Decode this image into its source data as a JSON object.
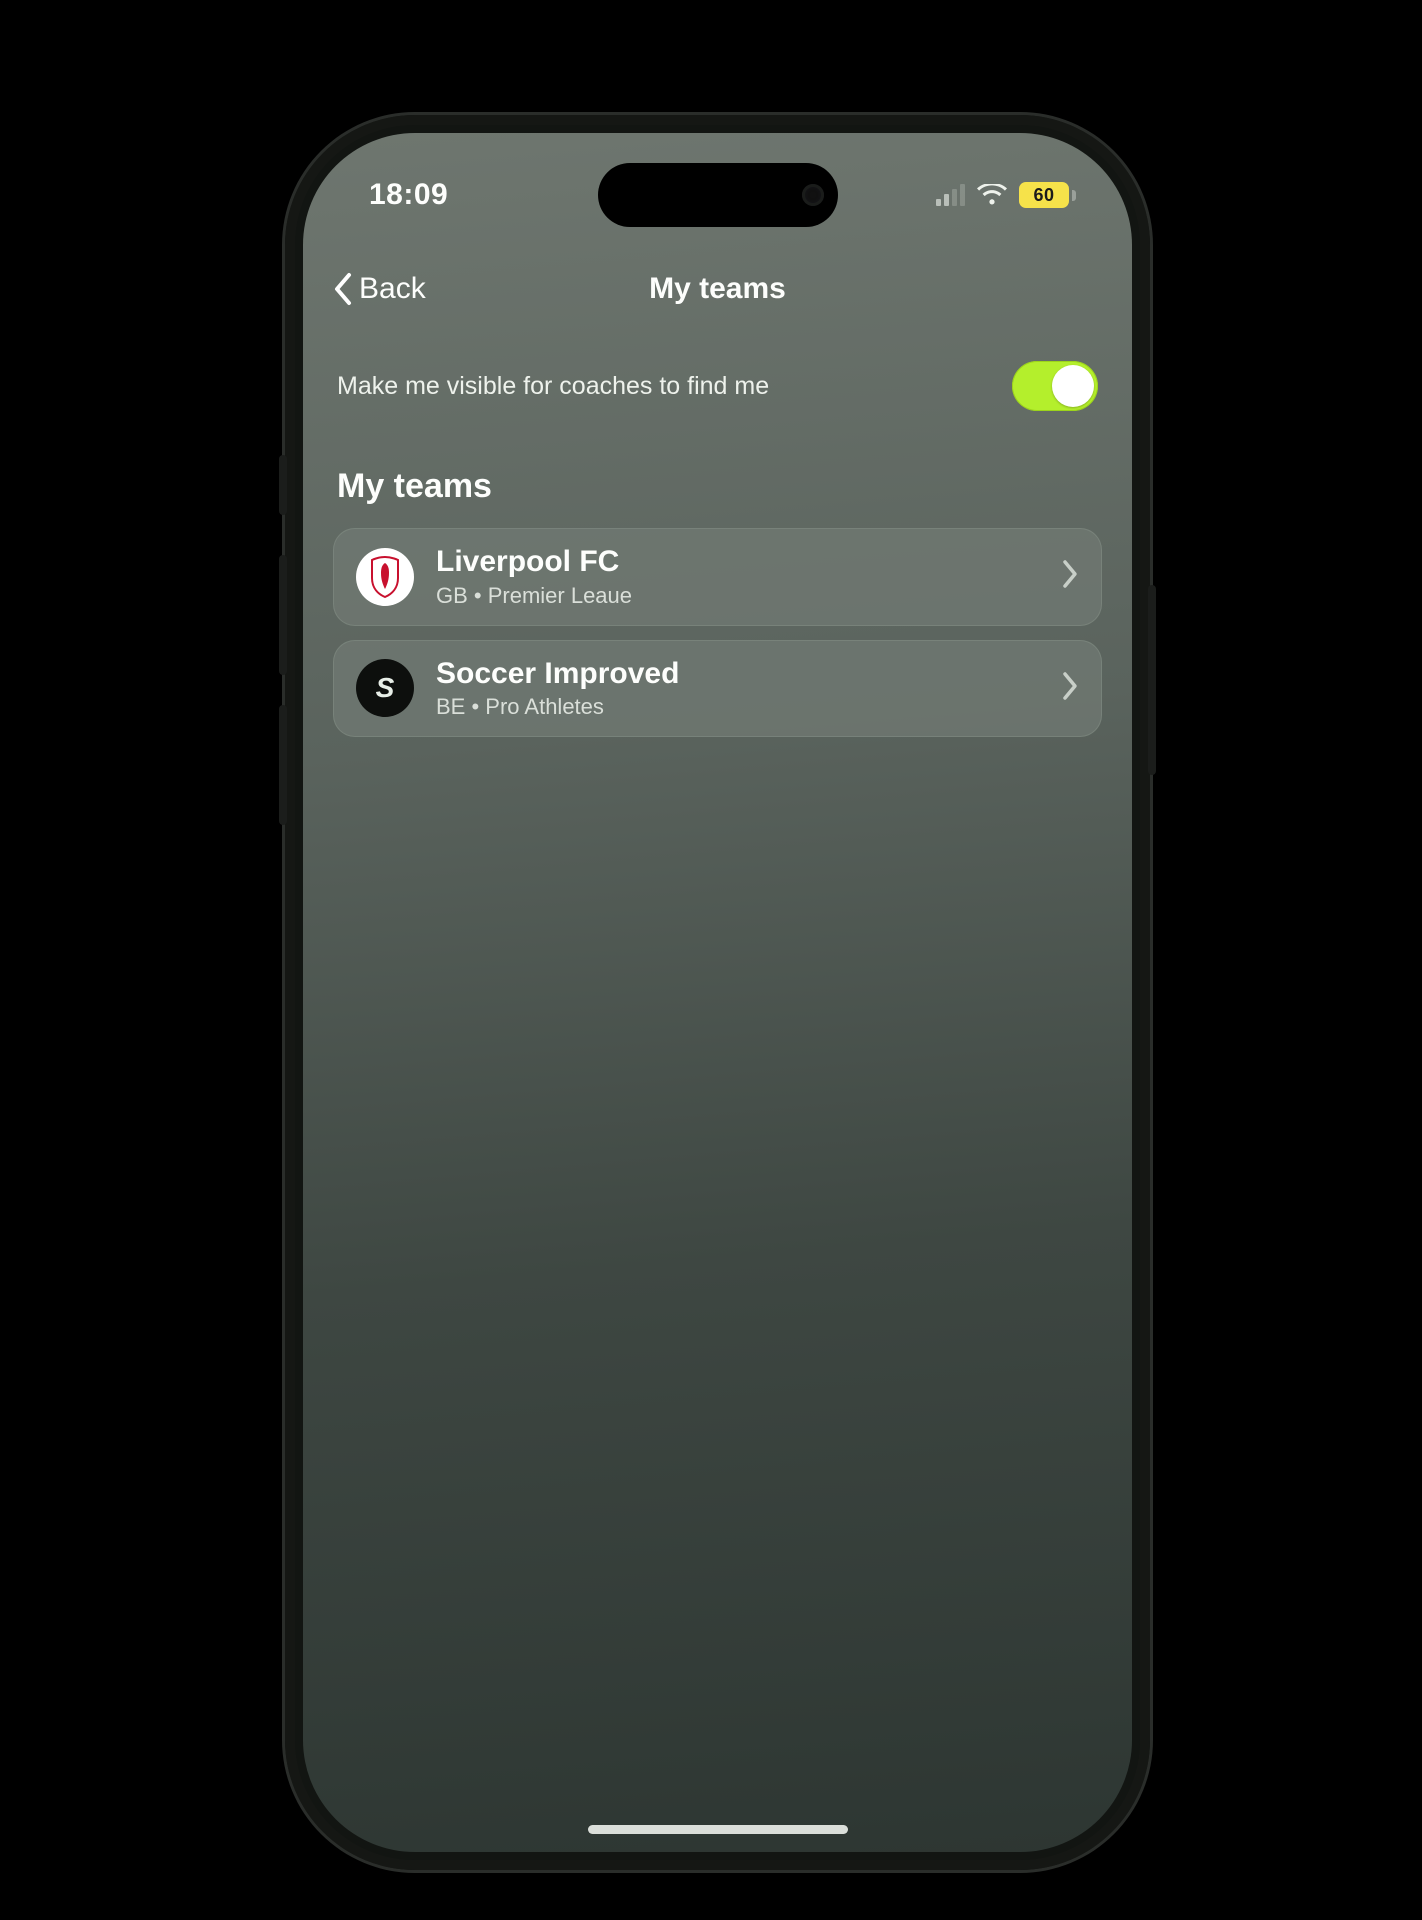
{
  "status": {
    "time": "18:09",
    "battery": "60"
  },
  "nav": {
    "back": "Back",
    "title": "My teams"
  },
  "visibility": {
    "label": "Make me visible for coaches to find me",
    "on": true
  },
  "section": {
    "heading": "My teams"
  },
  "teams": [
    {
      "name": "Liverpool FC",
      "sub": "GB • Premier Leaue",
      "logo_letter": "",
      "logo_style": "light",
      "logo_color": "#c8102e"
    },
    {
      "name": "Soccer Improved",
      "sub": "BE • Pro Athletes",
      "logo_letter": "S",
      "logo_style": "dark",
      "logo_color": "#e7eee7"
    }
  ]
}
